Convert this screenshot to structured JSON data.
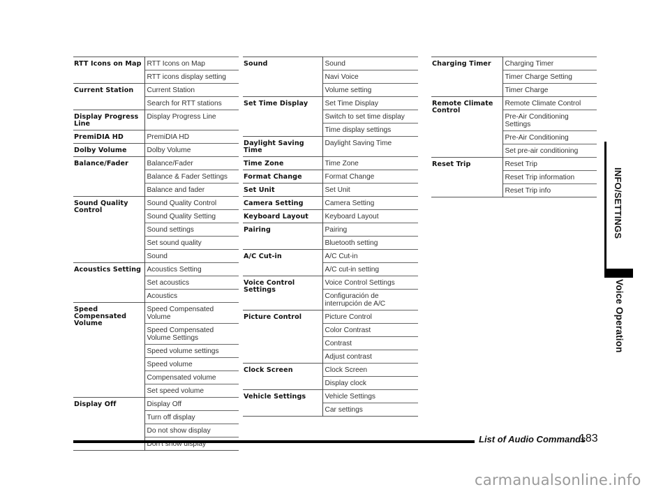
{
  "tables": [
    {
      "groups": [
        {
          "category": "RTT Icons on Map",
          "phrases": [
            "RTT Icons on Map",
            "RTT icons display setting"
          ]
        },
        {
          "category": "Current Station",
          "phrases": [
            "Current Station",
            "Search for RTT stations"
          ]
        },
        {
          "category": "Display Progress Line",
          "phrases": [
            "Display Progress Line"
          ],
          "tall": true
        },
        {
          "category": "PremiDIA HD",
          "phrases": [
            "PremiDIA HD"
          ]
        },
        {
          "category": "Dolby Volume",
          "phrases": [
            "Dolby Volume"
          ]
        },
        {
          "category": "Balance/Fader",
          "phrases": [
            "Balance/Fader",
            "Balance & Fader Settings",
            "Balance and fader"
          ]
        },
        {
          "category": "Sound Quality Control",
          "phrases": [
            "Sound Quality Control",
            "Sound Quality Setting",
            "Sound settings",
            "Set sound quality",
            "Sound"
          ]
        },
        {
          "category": "Acoustics Setting",
          "phrases": [
            "Acoustics Setting",
            "Set acoustics",
            "Acoustics"
          ]
        },
        {
          "category": "Speed Compensated Volume",
          "phrases": [
            "Speed Compensated Volume",
            "Speed Compensated Volume Settings",
            "Speed volume settings",
            "Speed volume",
            "Compensated volume",
            "Set speed volume"
          ]
        },
        {
          "category": "Display Off",
          "phrases": [
            "Display Off",
            "Turn off display",
            "Do not show display",
            "Don't show display"
          ]
        }
      ]
    },
    {
      "groups": [
        {
          "category": "Sound",
          "phrases": [
            "Sound",
            "Navi Voice",
            "Volume setting"
          ]
        },
        {
          "category": "Set Time Display",
          "phrases": [
            "Set Time Display",
            "Switch to set time display",
            "Time display settings"
          ]
        },
        {
          "category": "Daylight Saving Time",
          "phrases": [
            "Daylight Saving Time"
          ],
          "tall": true
        },
        {
          "category": "Time Zone",
          "phrases": [
            "Time Zone"
          ]
        },
        {
          "category": "Format Change",
          "phrases": [
            "Format Change"
          ]
        },
        {
          "category": "Set Unit",
          "phrases": [
            "Set Unit"
          ]
        },
        {
          "category": "Camera Setting",
          "phrases": [
            "Camera Setting"
          ]
        },
        {
          "category": "Keyboard Layout",
          "phrases": [
            "Keyboard Layout"
          ]
        },
        {
          "category": "Pairing",
          "phrases": [
            "Pairing",
            "Bluetooth setting"
          ]
        },
        {
          "category": "A/C Cut-in",
          "phrases": [
            "A/C Cut-in",
            "A/C cut-in setting"
          ]
        },
        {
          "category": "Voice Control Settings",
          "phrases": [
            "Voice Control Settings",
            "Configuración de interrupción de A/C"
          ]
        },
        {
          "category": "Picture Control",
          "phrases": [
            "Picture Control",
            "Color Contrast",
            "Contrast",
            "Adjust contrast"
          ]
        },
        {
          "category": "Clock Screen",
          "phrases": [
            "Clock Screen",
            "Display clock"
          ]
        },
        {
          "category": "Vehicle Settings",
          "phrases": [
            "Vehicle Settings",
            "Car settings"
          ]
        }
      ]
    },
    {
      "groups": [
        {
          "category": "Charging Timer",
          "phrases": [
            "Charging Timer",
            "Timer Charge Setting",
            "Timer Charge"
          ]
        },
        {
          "category": "Remote Climate Control",
          "phrases": [
            "Remote Climate Control",
            "Pre-Air Conditioning Settings",
            "Pre-Air Conditioning",
            "Set pre-air conditioning"
          ]
        },
        {
          "category": "Reset Trip",
          "phrases": [
            "Reset Trip",
            "Reset Trip information",
            "Reset Trip info"
          ]
        }
      ]
    }
  ],
  "side_tab": {
    "section": "INFO/SETTINGS",
    "chapter": "Voice Operation"
  },
  "footer": {
    "title": "List of Audio Commands",
    "page_number": "183"
  },
  "watermark": "carmanualsonline.info"
}
